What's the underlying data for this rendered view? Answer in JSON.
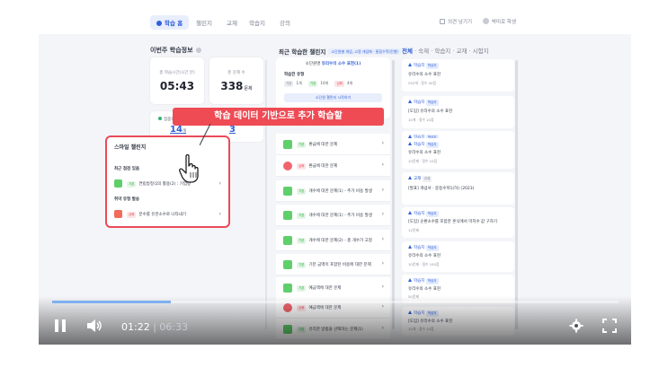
{
  "nav": {
    "tabs": [
      {
        "label": "학습 홈",
        "active": true
      },
      {
        "label": "챌린지"
      },
      {
        "label": "교재"
      },
      {
        "label": "학습지"
      },
      {
        "label": "강의"
      }
    ],
    "feedback": "의견 남기기",
    "user": "박미로 학생"
  },
  "weekly": {
    "title": "이번주 학습정보",
    "study_time_label": "총 학습시간(시간 분)",
    "study_time_value": "05:43",
    "solved_label": "푼 문제 수",
    "solved_value": "338",
    "solved_unit": "문제",
    "streak_label": "집중의 응시간 완료",
    "streak_value": "14",
    "streak_unit": "개",
    "best_label": "최고 집중률",
    "best_value": "3"
  },
  "banner": "학습 데이터 기반으로 추가 학습할",
  "smile": {
    "title": "스마일 챌린지",
    "sub1": "최근 점검 있음",
    "row1_tag": "기본",
    "row1_text": "연립방정식의 활용(2) : 기업량",
    "sub2": "취약 유형 발송",
    "row2_tag": "심화",
    "row2_text": "분수를 유한소수로 나타내기"
  },
  "middle": {
    "title": "최근 학습한 챌린지",
    "hint": "소단원별 개념, 고정 개념화 · 통합수학(진행)",
    "top_head_prefix": "소단원명",
    "top_head_value": "유리수의 소수 표현(1)",
    "top_label": "학습한 유형",
    "chip_basic": "기본",
    "chip_basic_count": "1개",
    "chip_mid": "기본",
    "chip_mid_count": "10개",
    "chip_hard": "심화",
    "chip_hard_count": "4개",
    "top_btn": "소단원 챌린지 시작하기",
    "rows": [
      {
        "tag": "기본",
        "text": "환급에 대한 문제",
        "color": "green"
      },
      {
        "tag": "심화",
        "text": "환급에 대한 문제",
        "color": "red"
      },
      {
        "tag": "기본",
        "text": "개수에 대한 문제(1) - 추가 비용 발생",
        "color": "green"
      },
      {
        "tag": "기본",
        "text": "개수에 대한 문제(1) - 추가 비용 발생",
        "color": "green"
      },
      {
        "tag": "기본",
        "text": "개수에 대한 문제(2) - 총 개수가 고정",
        "color": "green"
      },
      {
        "tag": "기본",
        "text": "기분 금액이 포함된 비용에 대한 문제",
        "color": "green"
      },
      {
        "tag": "기본",
        "text": "예금액에 대한 문제",
        "color": "green"
      },
      {
        "tag": "심화",
        "text": "예금액에 대한 문제",
        "color": "red"
      },
      {
        "tag": "기본",
        "text": "유리한 방법을 선택하는 문제(1)",
        "color": "green"
      }
    ]
  },
  "right": {
    "tabs": [
      "전체",
      "숙제",
      "학습지",
      "교재",
      "시험지"
    ],
    "cards": [
      {
        "kind": "학습지",
        "badge": "학습지",
        "title": "유리수의 소수 표현",
        "meta": "292개 · 정수 40점"
      },
      {
        "kind": "학습지",
        "badge": "학습지",
        "title": "[도입] 유리수의 소수 표현",
        "meta": "10개 · 정수 10점"
      },
      {
        "kind": "학습지",
        "badge": "학습지",
        "title": "[도입] 유리수의 소수 표현",
        "meta": "10개 · 정수 10점"
      },
      {
        "kind": "학습지",
        "badge": "학습지",
        "title": "유리수의 소수 표현",
        "meta": "10문제 · 정수 10점"
      },
      {
        "kind": "교재",
        "badge": "교재",
        "title": "[발표] 개념서 · 중등수학1(하) (2023)",
        "meta": ""
      },
      {
        "kind": "학습지",
        "badge": "학습지",
        "title": "[도입] 순환소수를 포함한 혼식에서 미지수 값 구하기",
        "meta": "12문제"
      },
      {
        "kind": "학습지",
        "badge": "학습지",
        "title": "유리수의 소수 표현",
        "meta": "10문제 · 정수 100점"
      },
      {
        "kind": "학습지",
        "badge": "학습지",
        "title": "유리수의 소수 표현",
        "meta": "50문제"
      },
      {
        "kind": "학습지",
        "badge": "학습지",
        "title": "[도입] 유리수의 소수 표현",
        "meta": "10개 · 정수 10점"
      }
    ]
  },
  "player": {
    "current": "01:22",
    "duration": "06:33",
    "progress": 0.21
  }
}
